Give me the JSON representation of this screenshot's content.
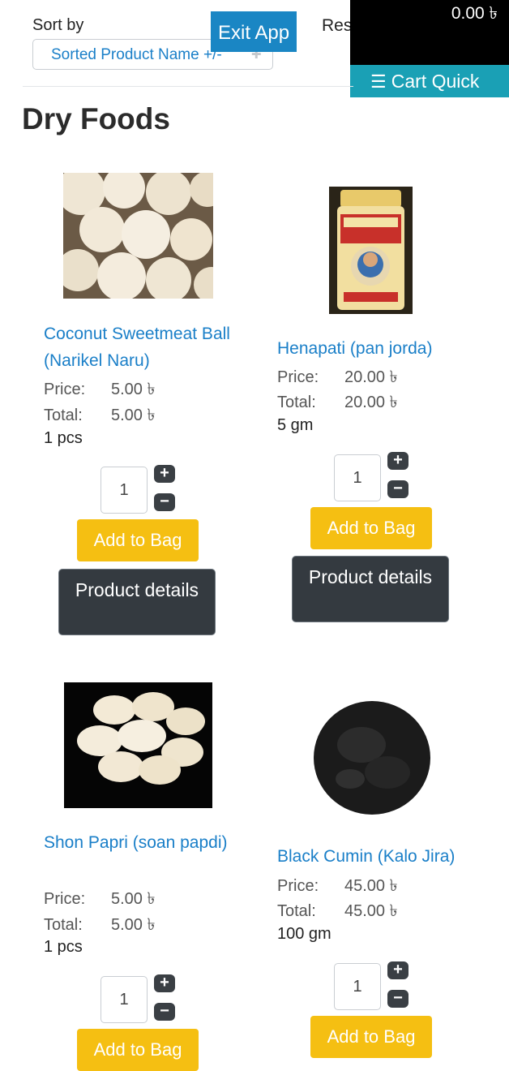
{
  "header": {
    "sort_label": "Sort by",
    "sort_value": "Sorted Product Name +/-",
    "exit_label": "Exit App",
    "reset_label": "Res",
    "cart_total": "0.00 ৳",
    "cart_quick_label": "Cart Quick"
  },
  "category": "Dry Foods",
  "products": [
    {
      "name": "Coconut Sweetmeat Ball (Narikel Naru)",
      "price_label": "Price:",
      "price": "5.00 ৳",
      "total_label": "Total:",
      "total": "5.00 ৳",
      "unit": "1 pcs",
      "qty": "1",
      "add_label": "Add to Bag",
      "details_label": "Product details"
    },
    {
      "name": "Henapati (pan jorda)",
      "price_label": "Price:",
      "price": "20.00 ৳",
      "total_label": "Total:",
      "total": "20.00 ৳",
      "unit": "5 gm",
      "qty": "1",
      "add_label": "Add to Bag",
      "details_label": "Product details"
    },
    {
      "name": "Shon Papri (soan papdi)",
      "price_label": "Price:",
      "price": "5.00 ৳",
      "total_label": "Total:",
      "total": "5.00 ৳",
      "unit": "1 pcs",
      "qty": "1",
      "add_label": "Add to Bag",
      "details_label": ""
    },
    {
      "name": "Black Cumin (Kalo Jira)",
      "price_label": "Price:",
      "price": "45.00 ৳",
      "total_label": "Total:",
      "total": "45.00 ৳",
      "unit": "100 gm",
      "qty": "1",
      "add_label": "Add to Bag",
      "details_label": ""
    }
  ],
  "icons": {
    "plus": "+",
    "minus": "−",
    "sort_arrow": "✚",
    "list": "☰"
  },
  "colors": {
    "link": "#1a7fc8",
    "exit": "#1a86c4",
    "cart_quick": "#1aa0b5",
    "add_to_bag": "#f5bf12",
    "details": "#343a40"
  }
}
